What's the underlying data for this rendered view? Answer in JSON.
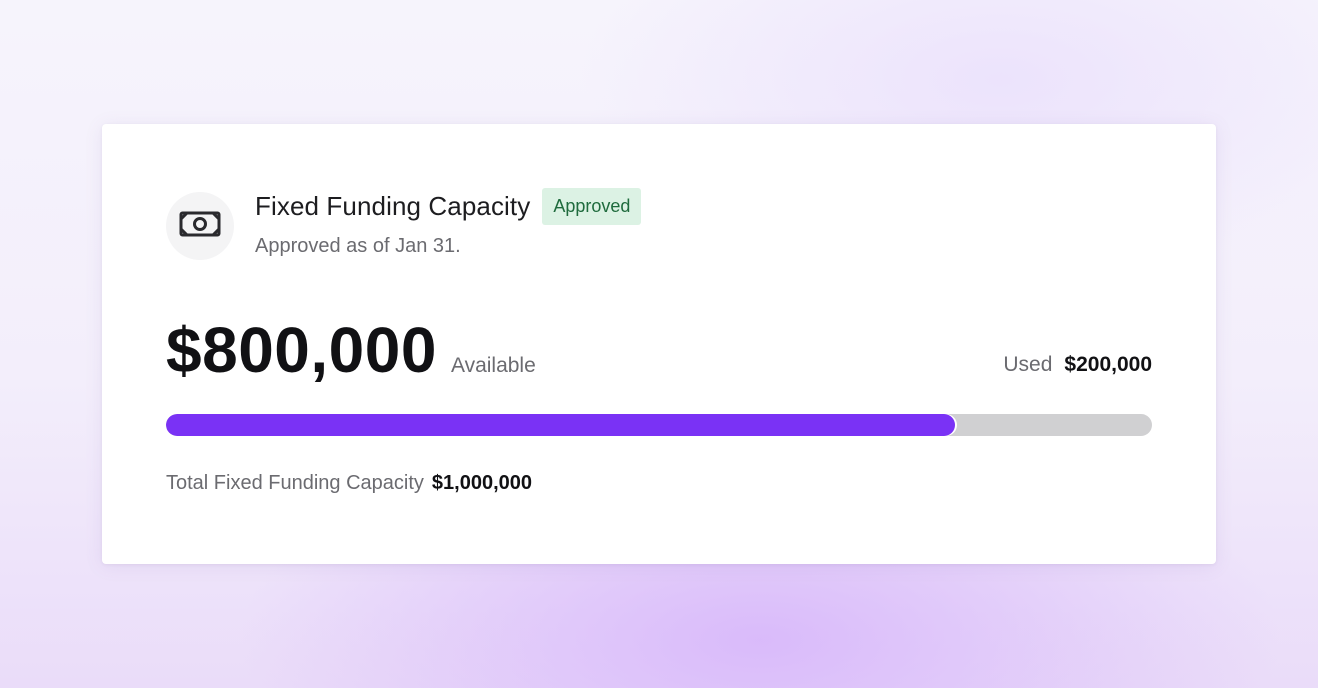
{
  "card": {
    "icon": "money-bill-icon",
    "title": "Fixed Funding Capacity",
    "status_badge": "Approved",
    "subtitle": "Approved as of Jan 31.",
    "available_amount": "$800,000",
    "available_label": "Available",
    "used_label": "Used",
    "used_amount": "$200,000",
    "total_label": "Total Fixed Funding Capacity",
    "total_amount": "$1,000,000",
    "progress_available_fraction": 0.8
  },
  "colors": {
    "accent": "#7a32f5",
    "track": "#d0d0d2",
    "badge_bg": "#dcf2e4",
    "badge_text": "#1f6b3d"
  }
}
